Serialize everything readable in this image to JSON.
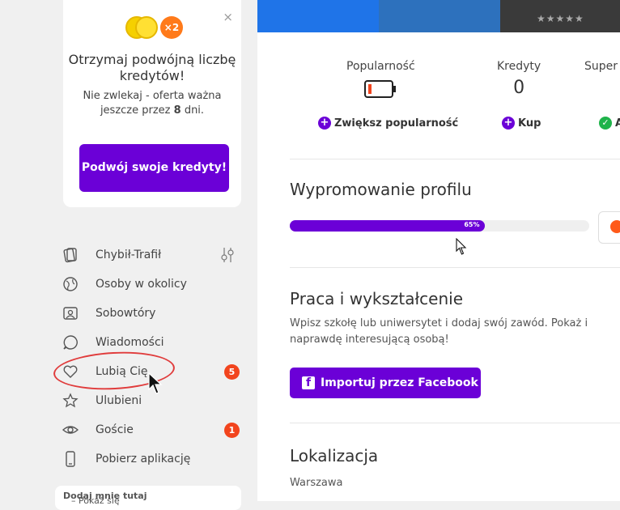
{
  "promo": {
    "close_symbol": "×",
    "multiplier": "×2",
    "title": "Otrzymaj podwójną liczbę kredytów!",
    "desc_prefix": "Nie zwlekaj - oferta ważna jeszcze przez ",
    "days": "8",
    "desc_suffix": "dni.",
    "button": "Podwój swoje kredyty!"
  },
  "nav": {
    "items": [
      {
        "label": "Chybił-Trafił",
        "icon": "cards-icon"
      },
      {
        "label": "Osoby w okolicy",
        "icon": "globe-icon"
      },
      {
        "label": "Sobowtóry",
        "icon": "lookalike-icon"
      },
      {
        "label": "Wiadomości",
        "icon": "chat-icon"
      },
      {
        "label": "Lubią Cię",
        "icon": "heart-icon",
        "badge": "5"
      },
      {
        "label": "Ulubieni",
        "icon": "star-icon"
      },
      {
        "label": "Goście",
        "icon": "eye-icon",
        "badge": "1"
      },
      {
        "label": "Pobierz aplikację",
        "icon": "phone-icon"
      }
    ]
  },
  "bottom_card": {
    "bold": "Dodaj mnie tutaj",
    "text": " – Pokaż się"
  },
  "banner": {
    "stars": "★★★★★"
  },
  "stats": {
    "popularity_label": "Popularność",
    "credits_label": "Kredyty",
    "credits_value": "0",
    "super_label": "Super",
    "increase_popularity": "Zwiększ popularność",
    "buy": "Kup",
    "activate": "A"
  },
  "promotion": {
    "title": "Wypromowanie profilu",
    "progress_label": "65%",
    "progress": 0.65
  },
  "work": {
    "title": "Praca i wykształcenie",
    "desc": "Wpisz szkołę lub uniwersytet i dodaj swój zawód. Pokaż i naprawdę interesującą osobą!",
    "button": "Importuj przez Facebook"
  },
  "location": {
    "title": "Lokalizacja",
    "value": "Warszawa"
  },
  "colors": {
    "accent": "#6b00d7",
    "badge": "#f2441d",
    "success": "#1fb34a"
  }
}
